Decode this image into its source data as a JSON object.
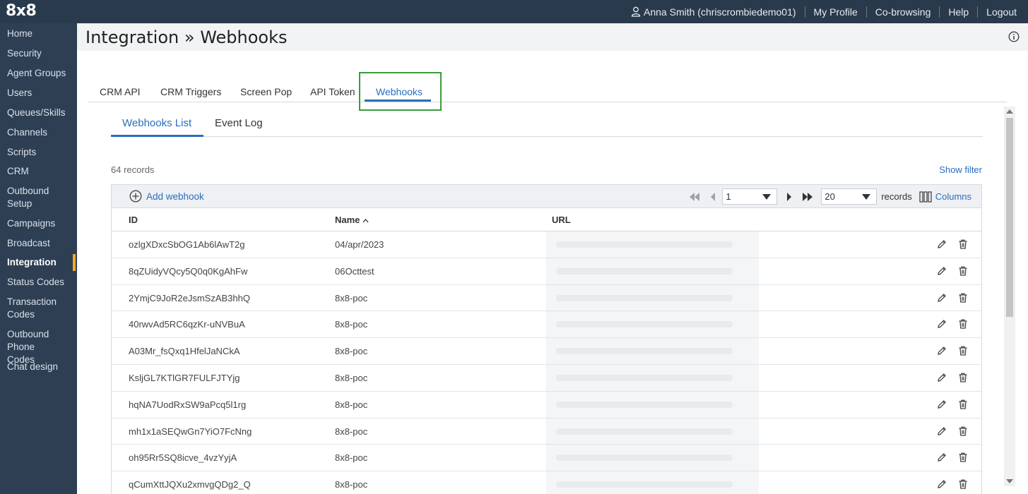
{
  "app": {
    "logo": "8x8"
  },
  "topnav": {
    "user": "Anna Smith (chriscrombiedemo01)",
    "links": [
      "My Profile",
      "Co-browsing",
      "Help",
      "Logout"
    ]
  },
  "sidebar": {
    "items": [
      {
        "label": "Home"
      },
      {
        "label": "Security"
      },
      {
        "label": "Agent Groups"
      },
      {
        "label": "Users"
      },
      {
        "label": "Queues/Skills"
      },
      {
        "label": "Channels"
      },
      {
        "label": "Scripts"
      },
      {
        "label": "CRM"
      },
      {
        "label": "Outbound Setup"
      },
      {
        "label": "Campaigns"
      },
      {
        "label": "Broadcast"
      },
      {
        "label": "Integration"
      },
      {
        "label": "Status Codes"
      },
      {
        "label": "Transaction Codes"
      },
      {
        "label": "Outbound Phone Codes"
      },
      {
        "label": "Chat design"
      }
    ],
    "active": "Integration"
  },
  "page": {
    "title": "Integration » Webhooks"
  },
  "tabs": [
    {
      "label": "CRM API"
    },
    {
      "label": "CRM Triggers"
    },
    {
      "label": "Screen Pop"
    },
    {
      "label": "API Token"
    },
    {
      "label": "Webhooks"
    }
  ],
  "subtabs": [
    {
      "label": "Webhooks List"
    },
    {
      "label": "Event Log"
    }
  ],
  "list": {
    "records_count": "64 records",
    "show_filter": "Show filter",
    "add_label": "Add webhook",
    "page": "1",
    "page_size": "20",
    "records_label": "records",
    "columns_label": "Columns",
    "headers": {
      "id": "ID",
      "name": "Name",
      "url": "URL"
    },
    "rows": [
      {
        "id": "ozlgXDxcSbOG1Ab6lAwT2g",
        "name": "04/apr/2023"
      },
      {
        "id": "8qZUidyVQcy5Q0q0KgAhFw",
        "name": "06Octtest"
      },
      {
        "id": "2YmjC9JoR2eJsmSzAB3hhQ",
        "name": "8x8-poc"
      },
      {
        "id": "40rwvAd5RC6qzKr-uNVBuA",
        "name": "8x8-poc"
      },
      {
        "id": "A03Mr_fsQxq1HfelJaNCkA",
        "name": "8x8-poc"
      },
      {
        "id": "KsljGL7KTlGR7FULFJTYjg",
        "name": "8x8-poc"
      },
      {
        "id": "hqNA7UodRxSW9aPcq5l1rg",
        "name": "8x8-poc"
      },
      {
        "id": "mh1x1aSEQwGn7YiO7FcNng",
        "name": "8x8-poc"
      },
      {
        "id": "oh95Rr5SQ8icve_4vzYyjA",
        "name": "8x8-poc"
      },
      {
        "id": "qCumXttJQXu2xmvgQDg2_Q",
        "name": "8x8-poc"
      }
    ]
  },
  "colors": {
    "topbar": "#2a3a4d",
    "sidebar": "#2e3f54",
    "accent": "#2a6ebf",
    "active_marker": "#f5a623",
    "highlight_box": "#3a9c3a"
  }
}
